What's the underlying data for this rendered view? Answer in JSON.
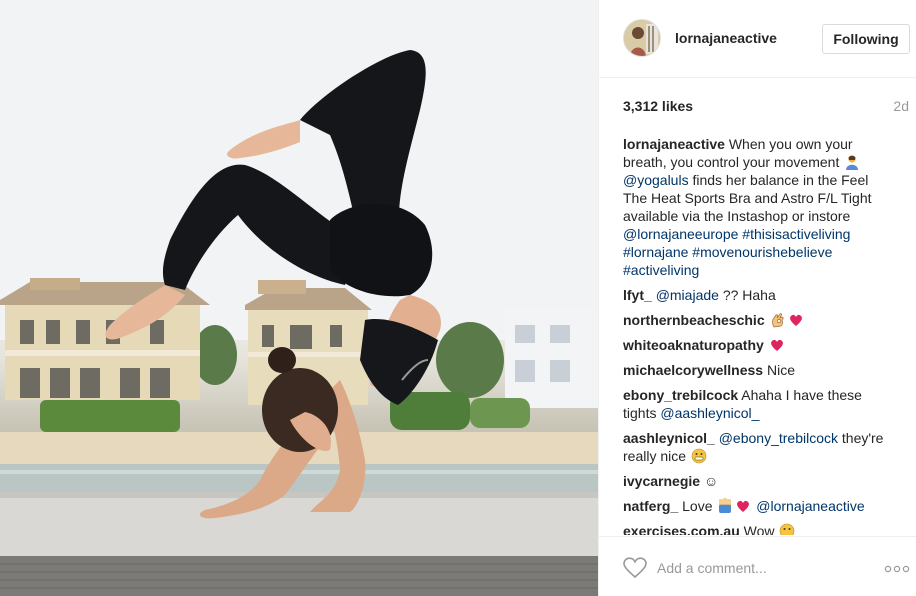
{
  "photo": {
    "alt_icon": "yoga-photo"
  },
  "header": {
    "username": "lornajaneactive",
    "follow_button_label": "Following",
    "avatar_icon": "profile-avatar"
  },
  "stats": {
    "likes": "3,312 likes",
    "time_ago": "2d"
  },
  "caption": {
    "user": "lornajaneactive",
    "text_1": " When you own your breath, you control your movement ",
    "mention_1": "@yogaluls",
    "text_2": " finds her balance in the Feel The Heat Sports Bra and Astro F/L Tight available via the Instashop or instore ",
    "mention_2": "@lornajaneeurope",
    "hashtag_1": "#thisisactiveliving",
    "hashtag_2": "#lornajane",
    "hashtag_3": "#movenourishebelieve",
    "hashtag_4": "#activeliving"
  },
  "comments": [
    {
      "user": "lfyt_",
      "mention": "@miajade",
      "text": " ?? Haha"
    },
    {
      "user": "northernbeacheschic",
      "text": ""
    },
    {
      "user": "whiteoaknaturopathy",
      "text": ""
    },
    {
      "user": "michaelcorywellness",
      "text": " Nice"
    },
    {
      "user": "ebony_trebilcock",
      "text": " Ahaha I have these tights ",
      "mention": "@aashleynicol_"
    },
    {
      "user": "aashleynicol_",
      "mention": "@ebony_trebilcock",
      "text": " they're really nice "
    },
    {
      "user": "ivycarnegie",
      "text": " ☺"
    },
    {
      "user": "natferg_",
      "text": " Love ",
      "mention": "@lornajaneactive"
    },
    {
      "user": "exercises.com.au",
      "text": " Wow "
    }
  ],
  "add_comment": {
    "placeholder": "Add a comment...",
    "like_icon": "heart-outline-icon",
    "more_icon": "more-options-icon"
  },
  "colors": {
    "link": "#003569",
    "text": "#262626",
    "muted": "#999999",
    "heart_red": "#ed4956"
  }
}
